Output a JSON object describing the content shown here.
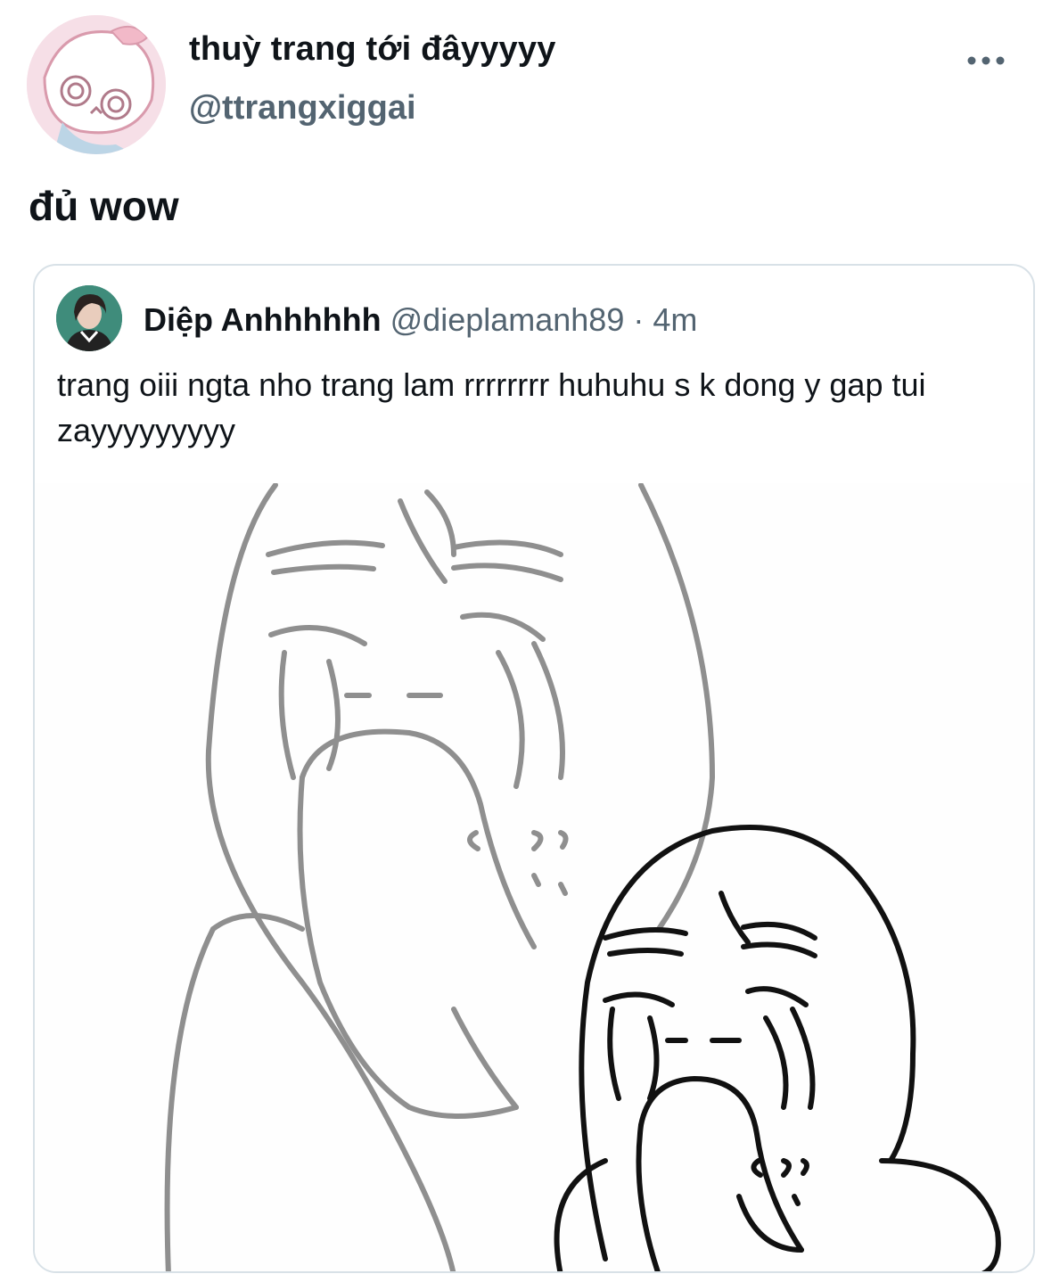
{
  "tweet": {
    "display_name": "thuỳ trang tới đâyyyyy",
    "handle": "@ttrangxiggai",
    "text": "đủ wow",
    "more_icon": "more-horizontal-icon",
    "avatar": "cartoon-avatar"
  },
  "quoted": {
    "display_name": "Diệp Anhhhhhh",
    "handle": "@dieplamanh89",
    "separator": "·",
    "time": "4m",
    "text": "trang oiii ngta nho trang lam rrrrrrrr huhuhu s k dong y gap tui zayyyyyyyyy",
    "image": "crying-meme-drawing"
  },
  "colors": {
    "text_primary": "#0f1419",
    "text_secondary": "#536471",
    "border": "#d8e1e7"
  }
}
